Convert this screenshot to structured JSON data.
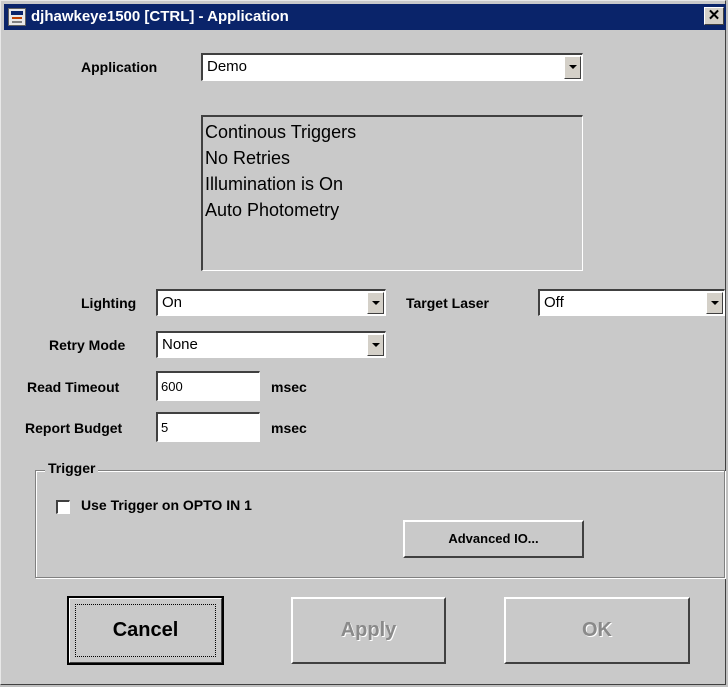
{
  "window": {
    "title": "djhawkeye1500 [CTRL] - Application",
    "close_glyph": "✕",
    "icon": "application-window-icon"
  },
  "application": {
    "label": "Application",
    "value": "Demo"
  },
  "info_lines": [
    "Continous Triggers",
    "No Retries",
    "Illumination is On",
    "Auto Photometry"
  ],
  "lighting": {
    "label": "Lighting",
    "value": "On"
  },
  "target_laser": {
    "label": "Target Laser",
    "value": "Off"
  },
  "retry_mode": {
    "label": "Retry Mode",
    "value": "None"
  },
  "read_timeout": {
    "label": "Read Timeout",
    "value": "600",
    "unit": "msec"
  },
  "report_budget": {
    "label": "Report Budget",
    "value": "5",
    "unit": "msec"
  },
  "trigger": {
    "group_label": "Trigger",
    "checkbox_label": "Use Trigger on OPTO IN 1",
    "checked": false,
    "advanced_label": "Advanced IO..."
  },
  "buttons": {
    "cancel": "Cancel",
    "apply": "Apply",
    "ok": "OK"
  },
  "colors": {
    "titlebar": "#0a246a",
    "face": "#c9c9c9",
    "disabled_text": "#8a8a8a"
  }
}
